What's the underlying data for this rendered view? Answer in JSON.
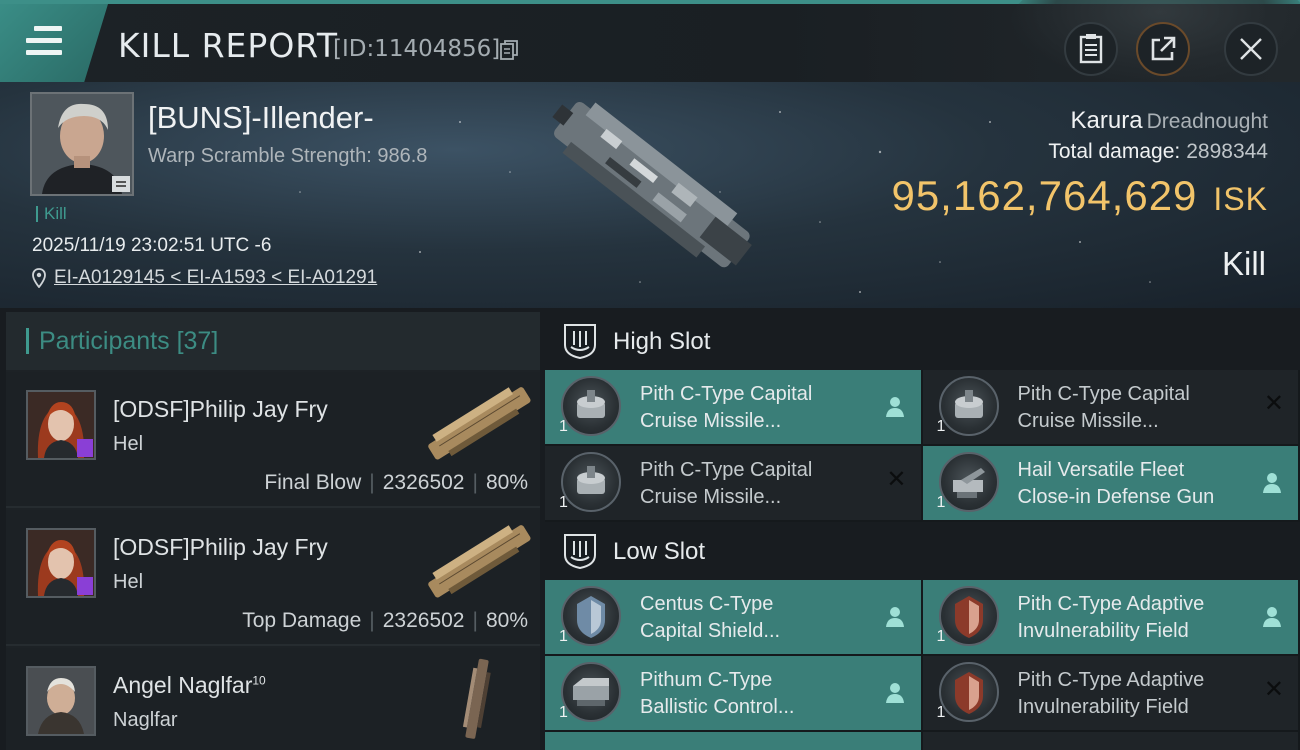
{
  "topbar": {
    "title": "KILL REPORT",
    "report_id": "[ID:11404856]",
    "icons": [
      "menu-icon",
      "copy-icon",
      "clipboard-icon",
      "share-icon",
      "close-icon"
    ]
  },
  "victim": {
    "name": "[BUNS]-Illender-",
    "warp_scramble": "Warp Scramble Strength: 986.8",
    "status_tag": "Kill",
    "datetime": "2025/11/19 23:02:51 UTC -6",
    "location": "EI-A0129145 < EI-A1593 < EI-A01291"
  },
  "ship": {
    "name": "Karura",
    "class": "Dreadnought",
    "total_damage_label": "Total damage:",
    "total_damage_value": "2898344",
    "isk_value": "95,162,764,629",
    "isk_unit": "ISK",
    "result": "Kill"
  },
  "participants": {
    "label": "Participants",
    "count": "[37]",
    "rows": [
      {
        "name": "[ODSF]Philip Jay Fry",
        "ship": "Hel",
        "role": "Final Blow",
        "damage": "2326502",
        "percent": "80%"
      },
      {
        "name": "[ODSF]Philip Jay Fry",
        "ship": "Hel",
        "role": "Top Damage",
        "damage": "2326502",
        "percent": "80%"
      },
      {
        "name": "Angel Naglfar",
        "sup": "10",
        "ship": "Naglfar"
      }
    ]
  },
  "high_slot": {
    "label": "High Slot",
    "modules": [
      {
        "line1": "Pith C-Type Capital",
        "line2": "Cruise Missile...",
        "qty": "1"
      },
      {
        "line1": "Pith C-Type Capital",
        "line2": "Cruise Missile...",
        "qty": "1"
      },
      {
        "line1": "Pith C-Type Capital",
        "line2": "Cruise Missile...",
        "qty": "1"
      },
      {
        "line1": "Hail Versatile Fleet",
        "line2": "Close-in Defense Gun",
        "qty": "1"
      }
    ]
  },
  "low_slot": {
    "label": "Low Slot",
    "modules": [
      {
        "line1": "Centus C-Type",
        "line2": "Capital Shield...",
        "qty": "1"
      },
      {
        "line1": "Pith C-Type Adaptive",
        "line2": "Invulnerability Field",
        "qty": "1"
      },
      {
        "line1": "Pithum C-Type",
        "line2": "Ballistic Control...",
        "qty": "1"
      },
      {
        "line1": "Pith C-Type Adaptive",
        "line2": "Invulnerability Field",
        "qty": "1"
      }
    ]
  },
  "colors": {
    "accent": "#3f9a8f",
    "module_active": "#3a7e78",
    "isk": "#f2c46a"
  }
}
